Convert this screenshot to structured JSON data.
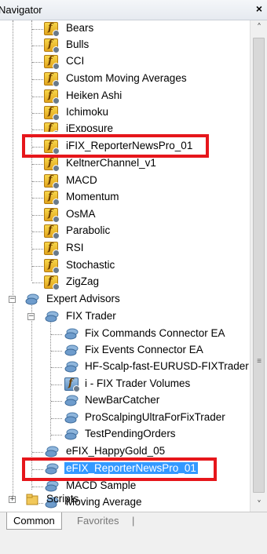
{
  "window": {
    "title": "Navigator",
    "close_label": "×"
  },
  "tree": {
    "indicators": [
      "Bears",
      "Bulls",
      "CCI",
      "Custom Moving Averages",
      "Heiken Ashi",
      "Ichimoku",
      "iExposure",
      "iFIX_ReporterNewsPro_01",
      "KeltnerChannel_v1",
      "MACD",
      "Momentum",
      "OsMA",
      "Parabolic",
      "RSI",
      "Stochastic",
      "ZigZag"
    ],
    "expert_advisors": {
      "label": "Expert Advisors",
      "fix_trader": {
        "label": "FIX Trader",
        "items": [
          "Fix Commands Connector EA",
          "Fix Events Connector EA",
          "HF-Scalp-fast-EURUSD-FIXTrader",
          "i - FIX Trader Volumes",
          "NewBarCatcher",
          "ProScalpingUltraForFixTrader",
          "TestPendingOrders"
        ]
      },
      "items": [
        "eFIX_HappyGold_05",
        "eFIX_ReporterNewsPro_01",
        "MACD Sample",
        "Moving Average"
      ]
    },
    "scripts_label": "Scripts"
  },
  "tabs": {
    "common": "Common",
    "favorites": "Favorites",
    "separator": "|"
  },
  "scrollbar": {
    "up_arrow": "˄",
    "down_arrow": "˅",
    "grip": "≡"
  },
  "colors": {
    "highlight": "#e6161b",
    "selection": "#3399ff"
  }
}
